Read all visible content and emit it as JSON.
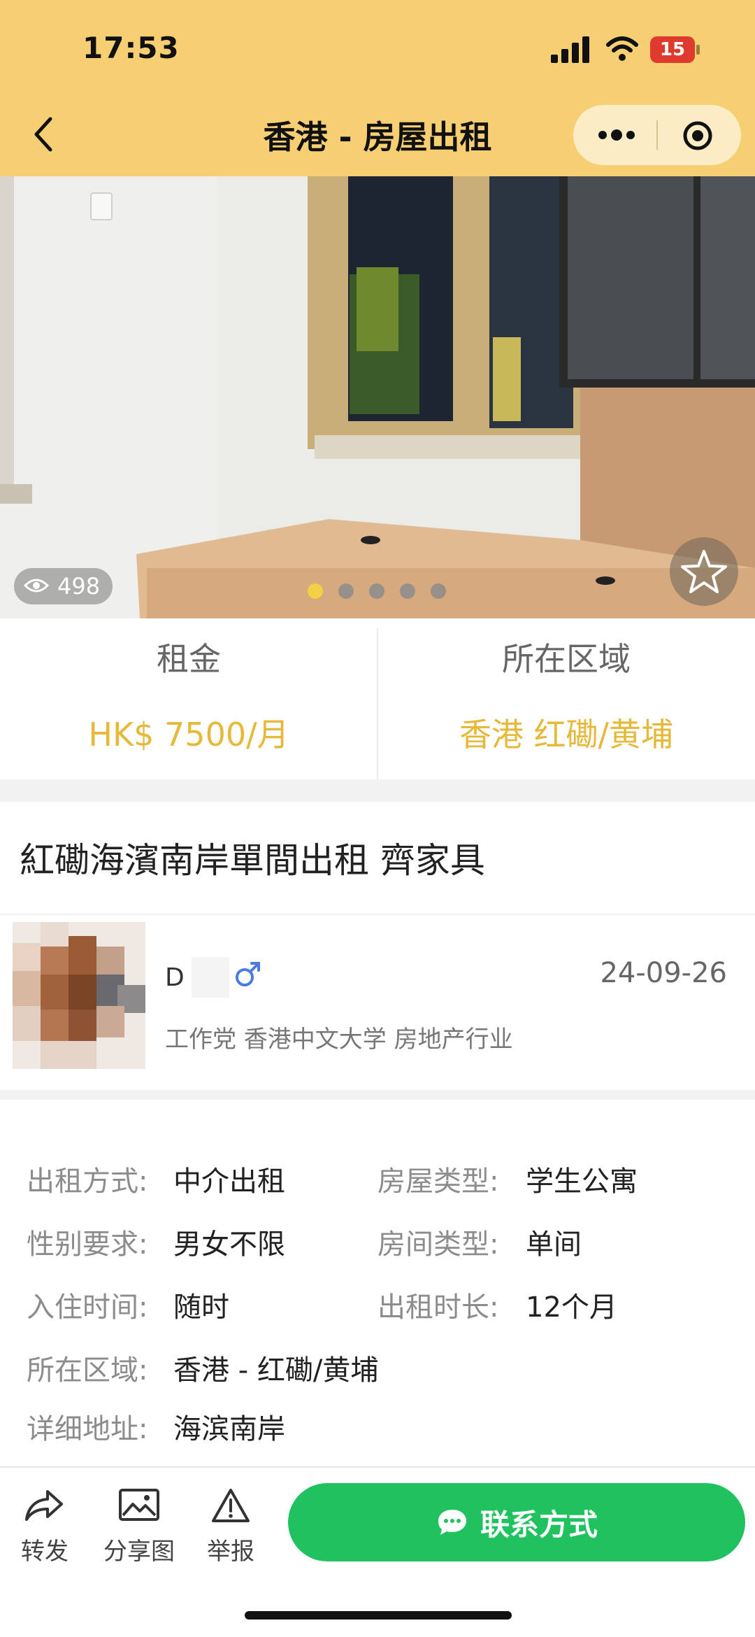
{
  "status_bar": {
    "time": "17:53",
    "battery": "15"
  },
  "header": {
    "title": "香港 - 房屋出租"
  },
  "photo": {
    "views": "498",
    "slide_count": 5,
    "active_slide": 0
  },
  "summary": {
    "rent_label": "租金",
    "rent_value": "HK$ 7500/月",
    "area_label": "所在区域",
    "area_value": "香港 红磡/黄埔"
  },
  "listing": {
    "title": "紅磡海濱南岸單間出租 齊家具"
  },
  "poster": {
    "name": "D",
    "date": "24-09-26",
    "tags": "工作党 香港中文大学 房地产行业"
  },
  "details": [
    {
      "label": "出租方式:",
      "value": "中介出租"
    },
    {
      "label": "房屋类型:",
      "value": "学生公寓"
    },
    {
      "label": "性别要求:",
      "value": "男女不限"
    },
    {
      "label": "房间类型:",
      "value": "单间"
    },
    {
      "label": "入住时间:",
      "value": "随时"
    },
    {
      "label": "出租时长:",
      "value": "12个月"
    },
    {
      "label": "所在区域:",
      "value": "香港 - 红磡/黄埔"
    },
    {
      "label": "详细地址:",
      "value": "海滨南岸"
    }
  ],
  "bottom_bar": {
    "share_label": "转发",
    "share_image_label": "分享图",
    "report_label": "举报",
    "contact_label": "联系方式"
  },
  "colors": {
    "header_bg": "#f5cf72",
    "accent": "#e6b93a",
    "contact_green": "#20c25f"
  }
}
